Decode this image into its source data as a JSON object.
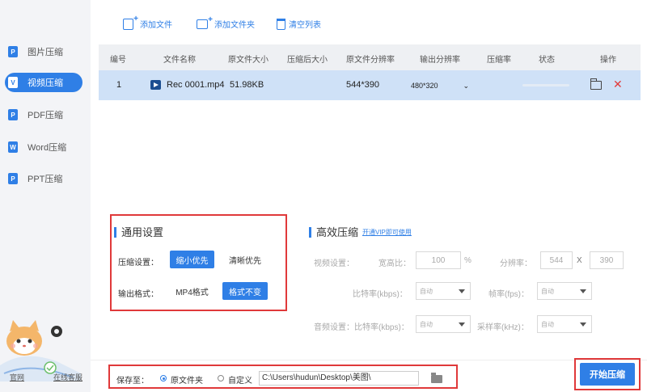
{
  "sidebar": {
    "items": [
      {
        "label": "图片压缩",
        "icon": "image-file-icon",
        "glyph": "P",
        "active": false
      },
      {
        "label": "视频压缩",
        "icon": "video-file-icon",
        "glyph": "V",
        "active": true
      },
      {
        "label": "PDF压缩",
        "icon": "pdf-file-icon",
        "glyph": "P",
        "active": false
      },
      {
        "label": "Word压缩",
        "icon": "word-file-icon",
        "glyph": "W",
        "active": false
      },
      {
        "label": "PPT压缩",
        "icon": "ppt-file-icon",
        "glyph": "P",
        "active": false
      }
    ],
    "bottom_links": [
      "官网",
      "在线客服"
    ]
  },
  "toolbar": {
    "add_file": "添加文件",
    "add_folder": "添加文件夹",
    "clear_list": "清空列表"
  },
  "table": {
    "headers": [
      "编号",
      "文件名称",
      "原文件大小",
      "压缩后大小",
      "原文件分辨率",
      "输出分辨率",
      "压缩率",
      "状态",
      "操作"
    ],
    "rows": [
      {
        "index": "1",
        "name": "Rec 0001.mp4",
        "orig_size": "51.98KB",
        "comp_size": "",
        "orig_res": "544*390",
        "output_res": "480*320",
        "ratio": "",
        "status_progress": 0
      }
    ]
  },
  "general": {
    "title": "通用设置",
    "compress_label": "压缩设置：",
    "opt_small": "缩小优先",
    "opt_clear": "清晰优先",
    "format_label": "输出格式：",
    "opt_mp4": "MP4格式",
    "opt_keep": "格式不变",
    "selected_compress": "缩小优先",
    "selected_format": "格式不变"
  },
  "efficient": {
    "title": "高效压缩",
    "vip_link": "开通VIP即可使用",
    "video_label": "视频设置：",
    "aspect_label": "宽高比：",
    "aspect_value": "100",
    "aspect_unit": "%",
    "resolution_label": "分辨率：",
    "res_w": "544",
    "res_x": "X",
    "res_h": "390",
    "bitrate_label": "比特率(kbps)：",
    "bitrate_value": "自动",
    "fps_label": "帧率(fps)：",
    "fps_value": "自动",
    "audio_label": "音频设置：比特率(kbps)：",
    "audio_bitrate_value": "自动",
    "sample_label": "采样率(kHz)：",
    "sample_value": "自动"
  },
  "save": {
    "label": "保存至：",
    "opt_original": "原文件夹",
    "opt_custom": "自定义",
    "selected": "原文件夹",
    "path": "C:\\Users\\hudun\\Desktop\\美图\\"
  },
  "start_button": "开始压缩",
  "colors": {
    "accent": "#2f7fe6",
    "highlight_border": "#e0393a",
    "selected_row": "#cfe1f7",
    "delete": "#e23b3b"
  }
}
